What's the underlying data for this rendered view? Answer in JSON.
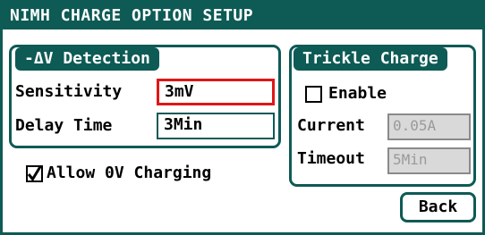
{
  "window": {
    "title": "NIMH CHARGE OPTION SETUP"
  },
  "delta_v": {
    "title": "-ΔV Detection",
    "sensitivity_label": "Sensitivity",
    "sensitivity_value": "3mV",
    "delay_label": "Delay Time",
    "delay_value": "3Min"
  },
  "allow_ov": {
    "label": "Allow 0V Charging",
    "checked": true
  },
  "trickle": {
    "title": "Trickle Charge",
    "enable_label": "Enable",
    "enabled": false,
    "current_label": "Current",
    "current_value": "0.05A",
    "timeout_label": "Timeout",
    "timeout_value": "5Min"
  },
  "back_button": {
    "label": "Back"
  },
  "colors": {
    "frame": "#0e5a55",
    "active_field": "#e01616",
    "disabled_field": "#d9d9d9"
  }
}
